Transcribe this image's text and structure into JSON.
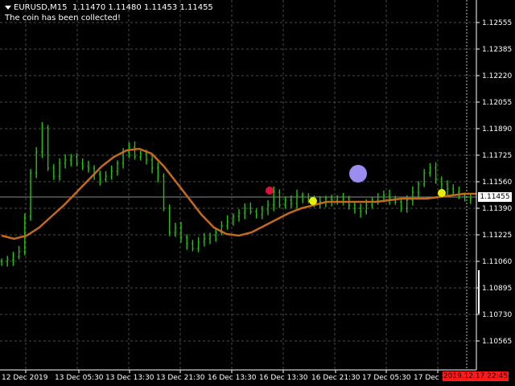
{
  "header": {
    "symbol": "EURUSD,M15",
    "ohlc": "1.11470 1.11480 1.11453 1.11455",
    "message": "The coin has been collected!"
  },
  "price_axis": {
    "ticks": [
      "1.12555",
      "1.12385",
      "1.12220",
      "1.12055",
      "1.11890",
      "1.11725",
      "1.11560",
      "1.11390",
      "1.11225",
      "1.11060",
      "1.10895",
      "1.10730",
      "1.10565"
    ],
    "current": "1.11455"
  },
  "time_axis": {
    "ticks": [
      "12 Dec 2019",
      "13 Dec 05:30",
      "13 Dec 13:30",
      "13 Dec 21:30",
      "16 Dec 13:30",
      "16 Dec 13:30",
      "16 Dec 21:30",
      "17 Dec 05:30",
      "17 Dec 1"
    ],
    "current": "2019.12.17 22:45"
  },
  "colors": {
    "background": "#000000",
    "grid": "#4a4a4a",
    "bars": "#22c40b",
    "ma": "#c46a1e",
    "coin_red": "#e0103a",
    "coin_yellow": "#e6f000",
    "ball": "#9b8cf0",
    "time_tag": "#ff1a1a"
  },
  "chart_data": {
    "type": "line",
    "series": [],
    "ylim": [
      1.104,
      1.127
    ],
    "grid": true,
    "bars": [
      1.1107,
      1.1108,
      1.111,
      1.1113,
      1.1135,
      1.1162,
      1.1175,
      1.119,
      1.1165,
      1.116,
      1.1168,
      1.117,
      1.1172,
      1.1168,
      1.1166,
      1.1165,
      1.1161,
      1.1158,
      1.116,
      1.1163,
      1.1168,
      1.1175,
      1.1178,
      1.1172,
      1.1174,
      1.117,
      1.1165,
      1.116,
      1.114,
      1.1125,
      1.1128,
      1.1122,
      1.1118,
      1.1115,
      1.1119,
      1.1121,
      1.1123,
      1.1125,
      1.1129,
      1.1132,
      1.1135,
      1.1137,
      1.114,
      1.1138,
      1.1136,
      1.1139,
      1.1142,
      1.115,
      1.1142,
      1.1145,
      1.1143,
      1.1148,
      1.1147,
      1.1145,
      1.1143,
      1.1144,
      1.1146,
      1.1145,
      1.1144,
      1.1146,
      1.1142,
      1.114,
      1.1138,
      1.1142,
      1.1145,
      1.1147,
      1.1148,
      1.1146,
      1.1144,
      1.114,
      1.1145,
      1.115,
      1.1155,
      1.1162,
      1.1165,
      1.1158,
      1.1155,
      1.1152,
      1.115,
      1.1148,
      1.1147,
      1.1146
    ],
    "ma": [
      1.1123,
      1.1121,
      1.1123,
      1.1128,
      1.1135,
      1.1142,
      1.115,
      1.1158,
      1.1166,
      1.1172,
      1.1176,
      1.1177,
      1.1174,
      1.1166,
      1.1156,
      1.1146,
      1.1136,
      1.1128,
      1.1124,
      1.1123,
      1.1125,
      1.1129,
      1.1133,
      1.1137,
      1.114,
      1.1142,
      1.1144,
      1.1144,
      1.1144,
      1.1144,
      1.1144,
      1.1145,
      1.1146,
      1.1146,
      1.1146,
      1.1147,
      1.1148,
      1.1149,
      1.1149
    ],
    "coins": [
      {
        "color": "red",
        "price": 1.1151
      },
      {
        "color": "yellow",
        "price": 1.11445
      },
      {
        "color": "yellow",
        "price": 1.11495
      }
    ],
    "ball_price": 1.11615
  }
}
